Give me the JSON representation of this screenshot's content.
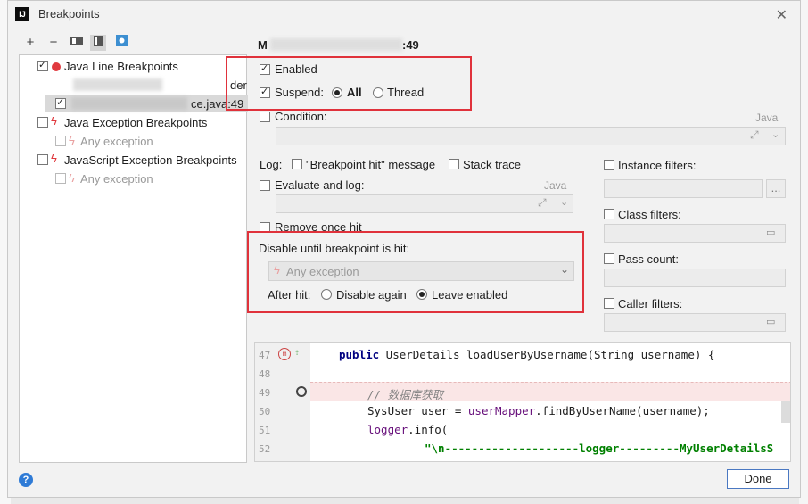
{
  "window": {
    "title": "Breakpoints",
    "app_logo": "IJ",
    "close_icon": "close-icon"
  },
  "toolbar": [
    "add-icon",
    "remove-icon",
    "group-by-package-icon",
    "group-by-file-icon",
    "export-icon"
  ],
  "tree": {
    "groups": [
      {
        "label": "Java Line Breakpoints",
        "checked": true,
        "icon": "red-dot-icon",
        "children": [
          {
            "label": "ce.java:49",
            "checked": true
          },
          {
            "label": "der",
            "checked": false
          }
        ]
      },
      {
        "label": "Java Exception Breakpoints",
        "checked": false,
        "icon": "lightning-icon",
        "children": [
          {
            "label": "Any exception",
            "checked": false
          }
        ]
      },
      {
        "label": "JavaScript Exception Breakpoints",
        "checked": false,
        "icon": "lightning-icon",
        "children": [
          {
            "label": "Any exception",
            "checked": false
          }
        ]
      }
    ]
  },
  "details": {
    "heading": "M",
    "heading_suffix": ":49",
    "enabled_label": "Enabled",
    "suspend_label": "Suspend:",
    "suspend_all": "All",
    "suspend_thread": "Thread",
    "condition_label": "Condition:",
    "condition_lang": "Java",
    "log_label": "Log:",
    "log_message_label": "\"Breakpoint hit\" message",
    "stack_trace_label": "Stack trace",
    "evaluate_label": "Evaluate and log:",
    "evaluate_lang": "Java",
    "remove_once_label": "Remove once hit",
    "disable_until_label": "Disable until breakpoint is hit:",
    "disable_until_value": "Any exception",
    "after_hit_label": "After hit:",
    "disable_again_label": "Disable again",
    "leave_enabled_label": "Leave enabled",
    "instance_filters_label": "Instance filters:",
    "class_filters_label": "Class filters:",
    "pass_count_label": "Pass count:",
    "caller_filters_label": "Caller filters:",
    "ellipsis": "...",
    "colors": {
      "highlight_box": "#e0323b",
      "breakpoint_line": "#fae6e6"
    }
  },
  "code": {
    "line_numbers": [
      "47",
      "48",
      "49",
      "50",
      "51",
      "52"
    ],
    "line47_kw": "public",
    "line47_rest": " UserDetails loadUserByUsername(String username) {",
    "line49_comment": "// 数据库获取",
    "line50_a": "SysUser user = ",
    "line50_b": "userMapper",
    "line50_c": ".findByUserName(username);",
    "line51_a": "logger",
    "line51_b": ".info(",
    "line52_str": "\"\\n--------------------logger---------MyUserDetailsS"
  },
  "footer": {
    "help": "?",
    "done_label": "Done"
  }
}
